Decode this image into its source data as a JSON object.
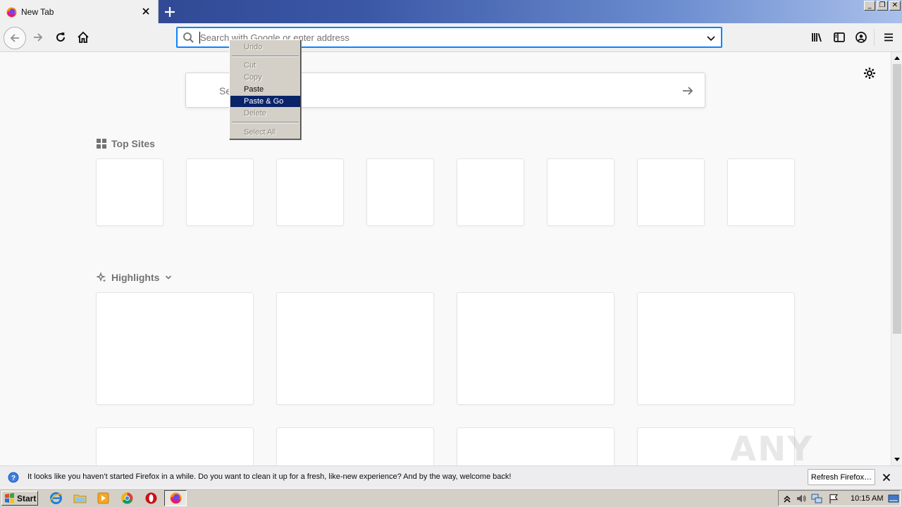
{
  "browser": {
    "tab": {
      "title": "New Tab"
    },
    "window_controls": {
      "minimize": "_",
      "restore": "❐",
      "close": "✕"
    },
    "urlbar": {
      "placeholder": "Search with Google or enter address"
    },
    "page_search": {
      "placeholder": "Se"
    },
    "sections": {
      "top_sites": {
        "title": "Top Sites",
        "tile_count": 8
      },
      "highlights": {
        "title": "Highlights",
        "card_count": 8
      }
    }
  },
  "context_menu": {
    "items": [
      {
        "label": "Undo",
        "enabled": false
      },
      {
        "label": "Cut",
        "enabled": false
      },
      {
        "label": "Copy",
        "enabled": false
      },
      {
        "label": "Paste",
        "enabled": true
      },
      {
        "label": "Paste & Go",
        "enabled": true,
        "highlighted": true
      },
      {
        "label": "Delete",
        "enabled": false
      },
      {
        "label": "Select All",
        "enabled": false
      }
    ]
  },
  "notification": {
    "message": "It looks like you haven’t started Firefox in a while. Do you want to clean it up for a fresh, like-new experience? And by the way, welcome back!",
    "button_label": "Refresh Firefox…"
  },
  "watermark": {
    "text": "ANY RUN"
  },
  "taskbar": {
    "start_label": "Start",
    "clock": "10:15 AM",
    "pinned_icons": [
      "ie-icon",
      "explorer-folder-icon",
      "media-player-icon",
      "chrome-icon",
      "opera-icon"
    ]
  },
  "colors": {
    "accent": "#0a84ff",
    "menu_highlight": "#0a246a",
    "titlebar": "#2b3f88"
  }
}
